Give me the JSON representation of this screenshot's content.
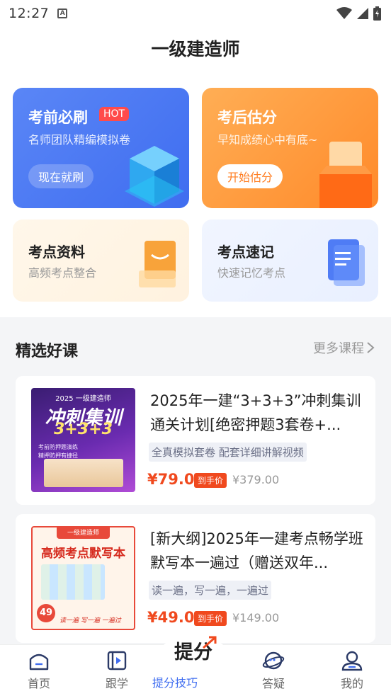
{
  "status": {
    "time": "12:27"
  },
  "header": {
    "title": "一级建造师"
  },
  "cards": {
    "mock": {
      "title": "考前必刷",
      "badge": "HOT",
      "subtitle": "名师团队精编模拟卷",
      "button": "现在就刷"
    },
    "estimate": {
      "title": "考后估分",
      "subtitle": "早知成绩心中有底~",
      "button": "开始估分"
    },
    "materials": {
      "title": "考点资料",
      "subtitle": "高频考点整合"
    },
    "memory": {
      "title": "考点速记",
      "subtitle": "快速记忆考点"
    }
  },
  "section": {
    "title": "精选好课",
    "more": "更多课程"
  },
  "courses": [
    {
      "title": "2025年一建“3+3+3”冲刺集训通关计划[绝密押题3套卷+...",
      "tag": "全真模拟套卷 配套详细讲解视频",
      "price": "¥79.0",
      "hand": "到手价",
      "original": "¥379.00",
      "thumb": {
        "top": "2025 一级建造师",
        "big1": "冲刺集训",
        "big2": "3+3+3",
        "line1": "考前防押题演练",
        "line2": "精押防押有捷径"
      }
    },
    {
      "title": "[新大纲]2025年一建考点畅学班默写本一遍过（赠送双年...",
      "tag": "读一遍，写一遍，一遍过",
      "price": "¥49.0",
      "hand": "到手价",
      "original": "¥149.00",
      "thumb": {
        "top": "一级建造师",
        "big1": "高频考点默写本",
        "badge": "49",
        "footer": "读一遍  写一遍  一遍过"
      }
    }
  ],
  "tabs": [
    {
      "label": "首页",
      "icon": "home-icon"
    },
    {
      "label": "跟学",
      "icon": "play-book-icon"
    },
    {
      "label": "提分技巧",
      "icon": "score-up-icon",
      "big": "提分"
    },
    {
      "label": "答疑",
      "icon": "planet-chat-icon"
    },
    {
      "label": "我的",
      "icon": "user-icon"
    }
  ],
  "colors": {
    "accent": "#3f6df0",
    "price": "#f0491e",
    "orange": "#ff8a2a"
  }
}
